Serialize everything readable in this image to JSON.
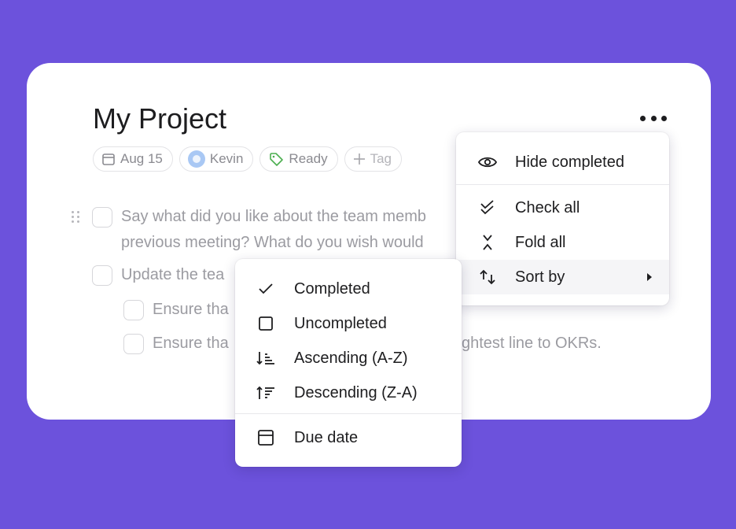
{
  "project": {
    "title": "My Project",
    "more_icon": "more-horizontal-icon"
  },
  "chips": {
    "date": "Aug 15",
    "assignee": "Kevin",
    "status": "Ready",
    "add_tag": "Tag"
  },
  "tasks": [
    {
      "line1": "Say what did you like about the team memb",
      "line2": "previous meeting? What do you wish would"
    },
    {
      "text": "Update the tea"
    },
    {
      "text": "Ensure tha"
    },
    {
      "text": "Ensure tha",
      "tail": "ghtest line to OKRs."
    }
  ],
  "options_menu": {
    "items": [
      {
        "label": "Hide completed",
        "icon": "eye-icon"
      },
      {
        "label": "Check all",
        "icon": "double-check-icon"
      },
      {
        "label": "Fold all",
        "icon": "fold-icon"
      },
      {
        "label": "Sort by",
        "icon": "sort-icon"
      }
    ]
  },
  "sort_menu": {
    "items": [
      {
        "label": "Completed",
        "icon": "check-icon"
      },
      {
        "label": "Uncompleted",
        "icon": "square-icon"
      },
      {
        "label": "Ascending (A-Z)",
        "icon": "sort-ascending-icon"
      },
      {
        "label": "Descending (Z-A)",
        "icon": "sort-descending-icon"
      },
      {
        "label": "Due date",
        "icon": "calendar-icon"
      }
    ]
  },
  "colors": {
    "background": "#6c52dc",
    "card": "#ffffff",
    "ready_tag": "#4caf50",
    "avatar": "#a9c8f4"
  }
}
